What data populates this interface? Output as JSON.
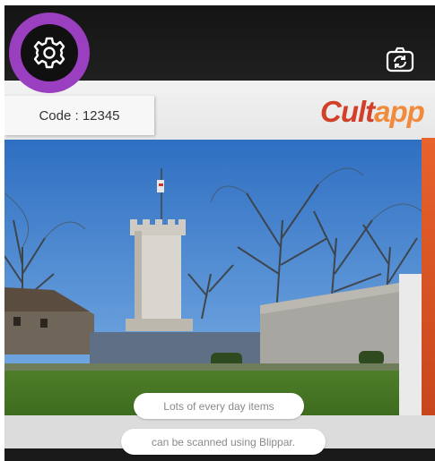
{
  "header": {
    "settings_icon": "gear-icon",
    "camera_icon": "camera-switch-icon",
    "accent_color": "#9a3fbf"
  },
  "slide": {
    "code_label": "Code : 12345",
    "logo": {
      "first": "C",
      "middle": "ult",
      "last": "app"
    },
    "logo_colors": {
      "primary": "#d2402a",
      "secondary": "#f08a3c"
    }
  },
  "captions": {
    "line1": "Lots of every day items",
    "line2": "can be scanned using Blippar."
  }
}
